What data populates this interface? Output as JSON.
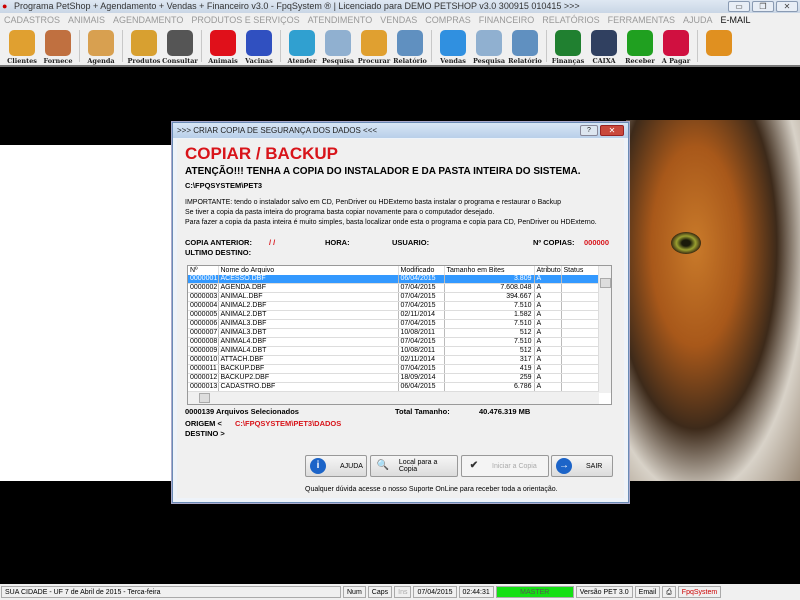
{
  "window": {
    "title": "Programa PetShop + Agendamento + Vendas + Financeiro v3.0 - FpqSystem ® | Licenciado para  DEMO PETSHOP v3.0 300915 010415 >>>"
  },
  "menu": [
    "CADASTROS",
    "ANIMAIS",
    "AGENDAMENTO",
    "PRODUTOS E SERVIÇOS",
    "ATENDIMENTO",
    "VENDAS",
    "COMPRAS",
    "FINANCEIRO",
    "RELATÓRIOS",
    "FERRAMENTAS",
    "AJUDA"
  ],
  "menu_email": "E-MAIL",
  "toolbar": [
    {
      "label": "Clientes",
      "icon": "clients-icon",
      "color": "#e0a030"
    },
    {
      "label": "Fornece",
      "icon": "supplier-icon",
      "color": "#c07040"
    },
    {
      "label": "Agenda",
      "icon": "calendar-icon",
      "color": "#d8a050"
    },
    {
      "label": "Produtos",
      "icon": "boxes-icon",
      "color": "#d8a030"
    },
    {
      "label": "Consultar",
      "icon": "barcode-icon",
      "color": "#555555"
    },
    {
      "label": "Animais",
      "icon": "paw-icon",
      "color": "#e0101a"
    },
    {
      "label": "Vacinas",
      "icon": "syringe-icon",
      "color": "#3050c0"
    },
    {
      "label": "Atender",
      "icon": "paw-plus-icon",
      "color": "#30a0d0"
    },
    {
      "label": "Pesquisa",
      "icon": "search-doc-icon",
      "color": "#90b0d0"
    },
    {
      "label": "Procurar",
      "icon": "folder-icon",
      "color": "#e0a030"
    },
    {
      "label": "Relatório",
      "icon": "printer-icon",
      "color": "#6090c0"
    },
    {
      "label": "Vendas",
      "icon": "monitor-icon",
      "color": "#3090e0"
    },
    {
      "label": "Pesquisa",
      "icon": "search-doc-icon",
      "color": "#90b0d0"
    },
    {
      "label": "Relatório",
      "icon": "printer-icon",
      "color": "#6090c0"
    },
    {
      "label": "Finanças",
      "icon": "finance-pie-icon",
      "color": "#208030"
    },
    {
      "label": "CAIXA",
      "icon": "cashbook-icon",
      "color": "#304060"
    },
    {
      "label": "Receber",
      "icon": "dollar-green-icon",
      "color": "#20a020"
    },
    {
      "label": "A Pagar",
      "icon": "dollar-red-icon",
      "color": "#d01040"
    },
    {
      "label": "",
      "icon": "exit-door-icon",
      "color": "#e09020"
    }
  ],
  "dialog": {
    "title": ">>> CRIAR COPIA DE SEGURANÇA DOS DADOS <<<",
    "heading": "COPIAR / BACKUP",
    "warning": "ATENÇÃO!!!  TENHA A COPIA DO  INSTALADOR  E  DA PASTA INTEIRA DO  SISTEMA.",
    "path": "C:\\FPQSYSTEM\\PET3",
    "important": [
      "IMPORTANTE: tendo o instalador salvo em CD, PenDriver ou HDExterno basta instalar o programa e restaurar o Backup",
      "Se tiver a copia da pasta inteira do programa basta copiar novamente para o computador desejado.",
      "Para fazer a copia da pasta inteira é muito simples, basta localizar onde esta o programa e copia para CD, PenDriver ou HDExterno."
    ],
    "copia_anterior_label": "COPIA ANTERIOR:",
    "copia_anterior_value": "/ /",
    "hora_label": "HORA:",
    "usuario_label": "USUARIO:",
    "ncopias_label": "Nº COPIAS:",
    "ncopias_value": "000000",
    "ultimo_destino_label": "ULTIMO DESTINO:",
    "columns": [
      "Nº",
      "Nome do Arquivo",
      "Modificado",
      "Tamanho em Bites",
      "Atributo",
      "Status"
    ],
    "rows": [
      [
        "0000001",
        "ACESSO.DBF",
        "06/04/2015",
        "3.809",
        "A",
        ""
      ],
      [
        "0000002",
        "AGENDA.DBF",
        "07/04/2015",
        "7.608.048",
        "A",
        ""
      ],
      [
        "0000003",
        "ANIMAL.DBF",
        "07/04/2015",
        "394.667",
        "A",
        ""
      ],
      [
        "0000004",
        "ANIMAL2.DBF",
        "07/04/2015",
        "7.510",
        "A",
        ""
      ],
      [
        "0000005",
        "ANIMAL2.DBT",
        "02/11/2014",
        "1.582",
        "A",
        ""
      ],
      [
        "0000006",
        "ANIMAL3.DBF",
        "07/04/2015",
        "7.510",
        "A",
        ""
      ],
      [
        "0000007",
        "ANIMAL3.DBT",
        "10/08/2011",
        "512",
        "A",
        ""
      ],
      [
        "0000008",
        "ANIMAL4.DBF",
        "07/04/2015",
        "7.510",
        "A",
        ""
      ],
      [
        "0000009",
        "ANIMAL4.DBT",
        "10/08/2011",
        "512",
        "A",
        ""
      ],
      [
        "0000010",
        "ATTACH.DBF",
        "02/11/2014",
        "317",
        "A",
        ""
      ],
      [
        "0000011",
        "BACKUP.DBF",
        "07/04/2015",
        "419",
        "A",
        ""
      ],
      [
        "0000012",
        "BACKUP2.DBF",
        "18/09/2014",
        "259",
        "A",
        ""
      ],
      [
        "0000013",
        "CADASTRO.DBF",
        "06/04/2015",
        "6.786",
        "A",
        ""
      ]
    ],
    "selected_count": "0000139 Arquivos  Selecionados",
    "total_label": "Total Tamanho:",
    "total_value": "40.476.319 MB",
    "origem_label": "ORIGEM  <",
    "origem_value": "C:\\FPQSYSTEM\\PET3\\DADOS",
    "destino_label": "DESTINO >",
    "buttons": {
      "ajuda": "AJUDA",
      "local": "Local para a Copia",
      "iniciar": "Iniciar a Copia",
      "sair": "SAIR"
    },
    "note": "Qualquer dúvida acesse o nosso Suporte OnLine para receber toda a orientação."
  },
  "statusbar": {
    "city": "SUA CIDADE - UF  7 de Abril de 2015 - Terca-feira",
    "num": "Num",
    "caps": "Caps",
    "ins": "Ins",
    "date": "07/04/2015",
    "time": "02:44:31",
    "user": "MASTER",
    "version": "Versão PET 3.0",
    "email": "Email",
    "brand": "FpqSystem"
  }
}
